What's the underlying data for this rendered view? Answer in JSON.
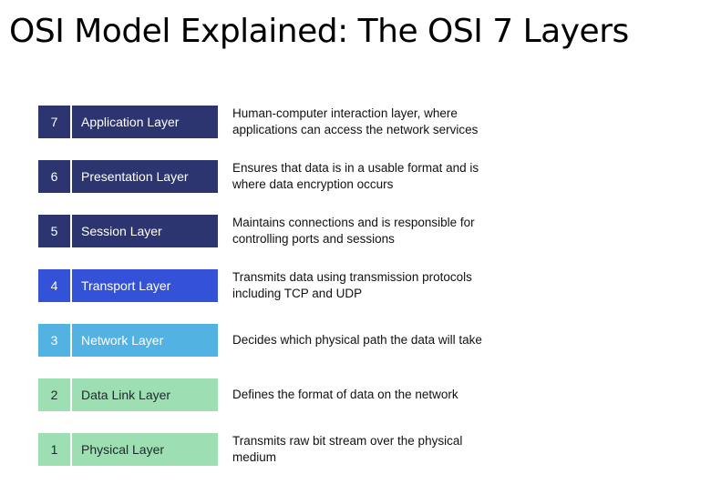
{
  "title": "OSI Model Explained: The OSI 7 Layers",
  "layers": [
    {
      "number": "7",
      "name": "Application Layer",
      "description": "Human-computer interaction layer, where applications can access the network services",
      "color": "#2c3570"
    },
    {
      "number": "6",
      "name": "Presentation Layer",
      "description": "Ensures that data is in a usable format and is where data encryption occurs",
      "color": "#2c3570"
    },
    {
      "number": "5",
      "name": "Session Layer",
      "description": "Maintains connections and is responsible for controlling ports and sessions",
      "color": "#2c3570"
    },
    {
      "number": "4",
      "name": "Transport Layer",
      "description": "Transmits data using transmission protocols including TCP and UDP",
      "color": "#3352d8"
    },
    {
      "number": "3",
      "name": "Network Layer",
      "description": "Decides which physical path the data will take",
      "color": "#52b3e2"
    },
    {
      "number": "2",
      "name": "Data Link Layer",
      "description": "Defines the format of data on the network",
      "color": "#9ddfb3"
    },
    {
      "number": "1",
      "name": "Physical Layer",
      "description": "Transmits raw bit stream over the physical medium",
      "color": "#9ddfb3"
    }
  ]
}
